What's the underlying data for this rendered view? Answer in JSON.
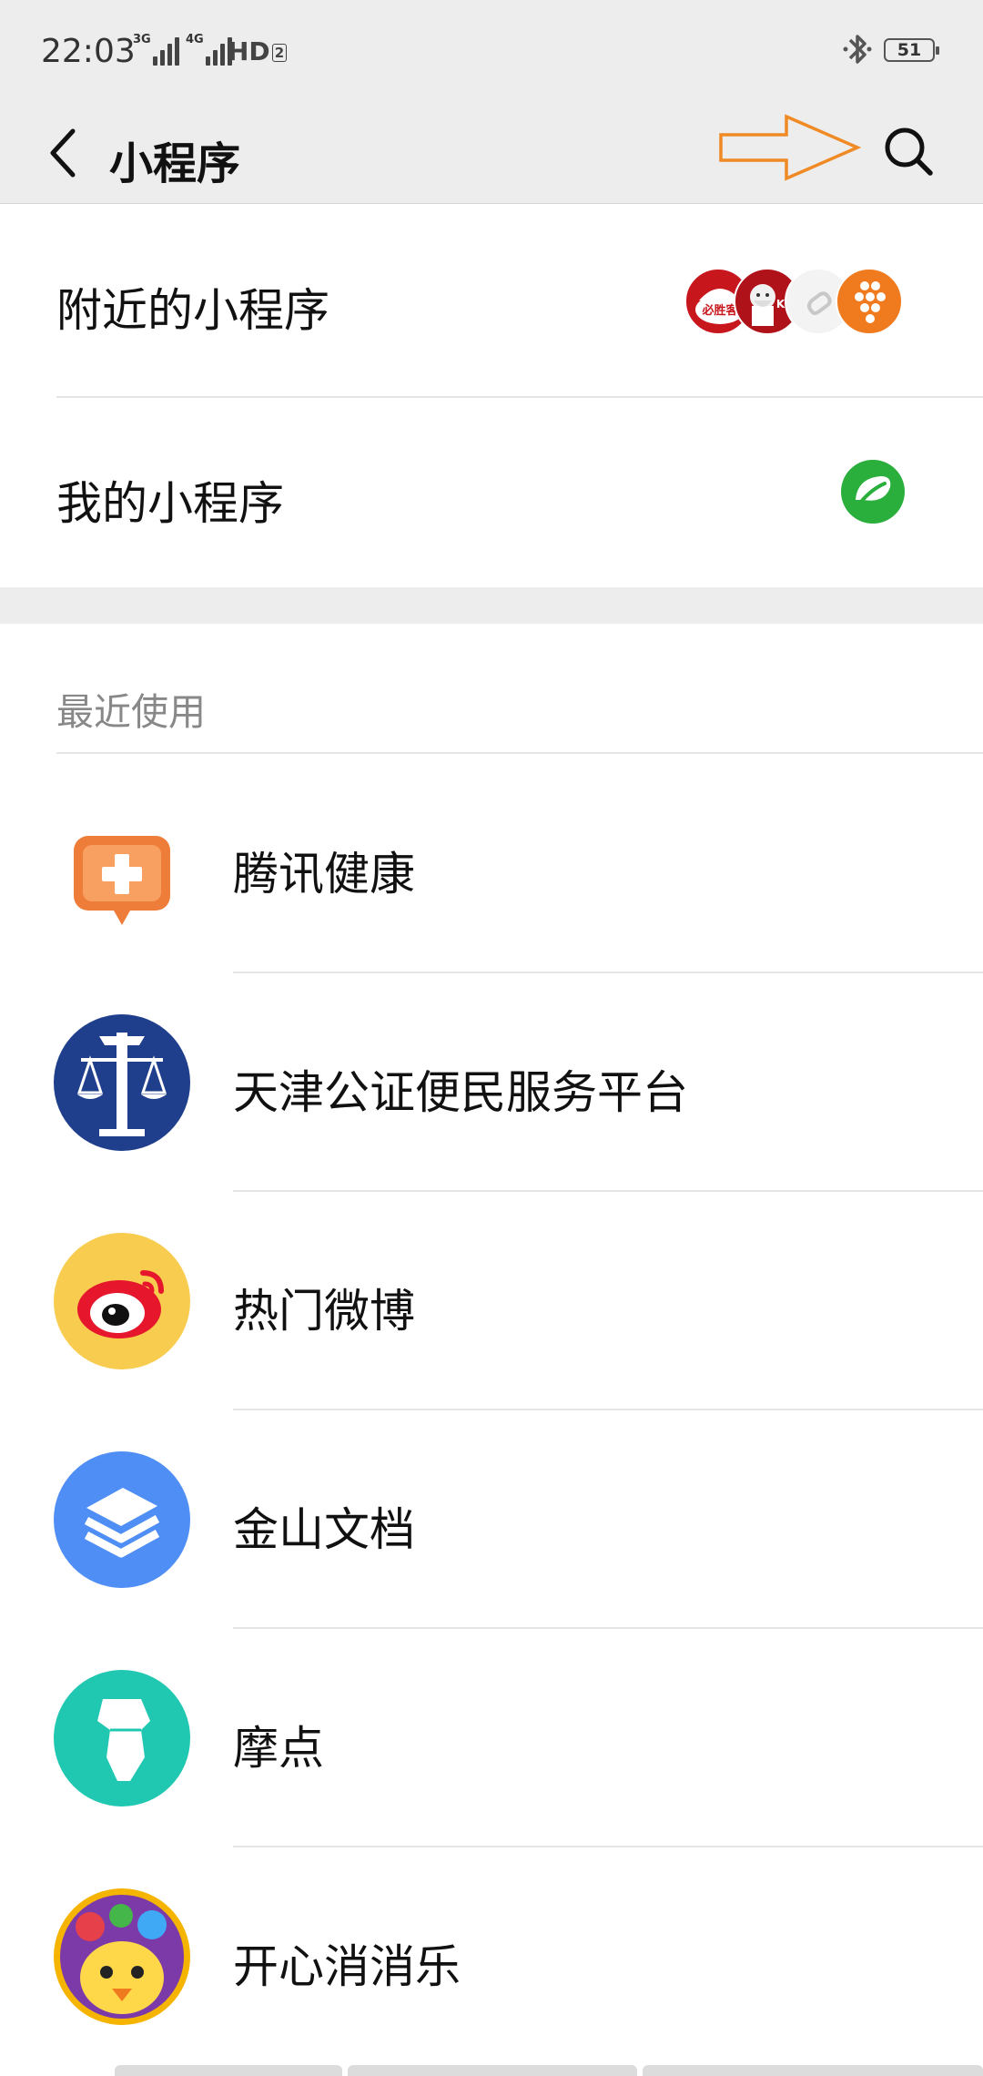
{
  "status_bar": {
    "time": "22:03",
    "network_1": "3G",
    "network_2": "4G",
    "hd_label": "HD",
    "hd_sub": "2",
    "battery_level": "51"
  },
  "nav": {
    "title": "小程序",
    "back_icon": "chevron-left-icon",
    "search_icon": "search-icon",
    "annotation_arrow_color": "#f08a24"
  },
  "rows": {
    "nearby": {
      "label": "附近的小程序",
      "icon_labels": [
        "必胜客",
        "KFC"
      ]
    },
    "mine": {
      "label": "我的小程序"
    }
  },
  "recent": {
    "header": "最近使用",
    "items": [
      {
        "name": "腾讯健康",
        "icon": "tencent-health-icon",
        "color": "#f07a3c"
      },
      {
        "name": "天津公证便民服务平台",
        "icon": "notary-emblem-icon",
        "color": "#1f3f8c"
      },
      {
        "name": "热门微博",
        "icon": "weibo-icon",
        "color": "#f7c948"
      },
      {
        "name": "金山文档",
        "icon": "kingsoft-docs-icon",
        "color": "#4f8ef5"
      },
      {
        "name": "摩点",
        "icon": "modian-icon",
        "color": "#23c9b0"
      },
      {
        "name": "开心消消乐",
        "icon": "happy-elimination-icon",
        "color": "#f5b400"
      }
    ]
  },
  "colors": {
    "background_gray": "#ededed",
    "divider": "#e5e5e5",
    "secondary_text": "#888888"
  }
}
